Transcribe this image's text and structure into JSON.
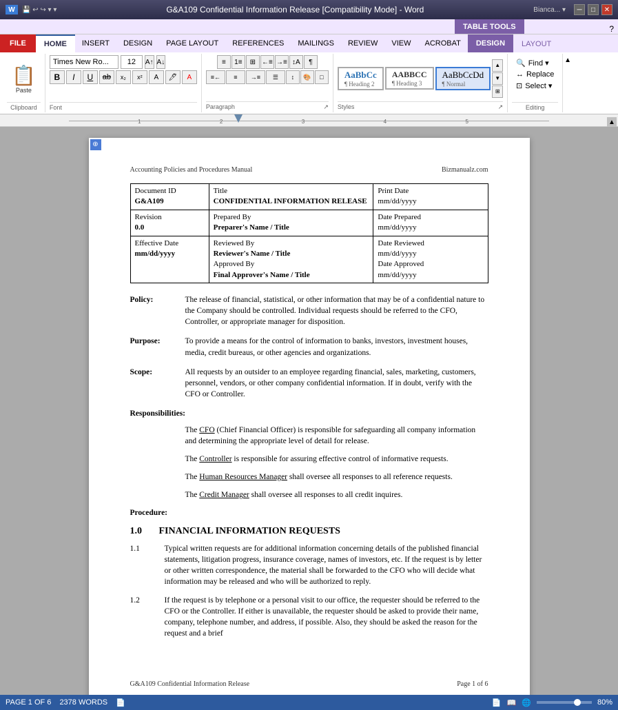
{
  "titlebar": {
    "title": "G&A109 Confidential Information Release [Compatibility Mode] - Word",
    "table_tools": "TABLE TOOLS",
    "icon": "W"
  },
  "tabs": {
    "main": [
      "FILE",
      "HOME",
      "INSERT",
      "DESIGN",
      "PAGE LAYOUT",
      "REFERENCES",
      "MAILINGS",
      "REVIEW",
      "VIEW",
      "ACROBAT"
    ],
    "table_tools": [
      "DESIGN",
      "LAYOUT"
    ],
    "active": "HOME",
    "active_table": "DESIGN"
  },
  "ribbon": {
    "font_name": "Times New Ro...",
    "font_size": "12",
    "paste_label": "Paste",
    "clipboard_label": "Clipboard",
    "font_label": "Font",
    "paragraph_label": "Paragraph",
    "styles_label": "Styles",
    "editing_label": "Editing"
  },
  "styles": {
    "items": [
      {
        "label": "AaBbCc",
        "sublabel": "¶ Heading 2",
        "type": "h2"
      },
      {
        "label": "AABBCC",
        "sublabel": "¶ Heading 3",
        "type": "h3"
      },
      {
        "label": "AaBbCcDd",
        "sublabel": "¶ Normal",
        "type": "normal",
        "selected": true
      }
    ]
  },
  "editing": {
    "find": "Find ▾",
    "replace": "Replace",
    "select": "Select ▾"
  },
  "document": {
    "header_left": "Accounting Policies and Procedures Manual",
    "header_right": "Bizmanualz.com",
    "table": {
      "rows": [
        [
          {
            "label": "Document ID",
            "value": "G&A109"
          },
          {
            "label": "Title",
            "value": "CONFIDENTIAL INFORMATION RELEASE"
          },
          {
            "label": "Print Date",
            "value": "mm/dd/yyyy"
          }
        ],
        [
          {
            "label": "Revision",
            "value": "0.0"
          },
          {
            "label": "Prepared By",
            "value": "Preparer's Name / Title"
          },
          {
            "label": "Date Prepared",
            "value": "mm/dd/yyyy"
          }
        ],
        [
          {
            "label": "Effective Date",
            "value": "mm/dd/yyyy"
          },
          {
            "label": "Reviewed By",
            "value": "Reviewer's Name / Title",
            "extra": "Approved By",
            "extra_value": "Final Approver's Name / Title"
          },
          {
            "label": "Date Reviewed",
            "value": "mm/dd/yyyy",
            "extra_label": "Date Approved",
            "extra_value": "mm/dd/yyyy"
          }
        ]
      ]
    },
    "policy": {
      "label": "Policy:",
      "text": "The release of financial, statistical, or other information that may be of a confidential nature to the Company should be controlled.  Individual requests should be referred to the CFO, Controller, or appropriate manager for disposition."
    },
    "purpose": {
      "label": "Purpose:",
      "text": "To provide a means for the control of information to banks, investors, investment houses, media, credit bureaus, or other agencies and organizations."
    },
    "scope": {
      "label": "Scope:",
      "text": "All requests by an outsider to an employee regarding financial, sales, marketing, customers, personnel, vendors, or other company confidential information.  If in doubt, verify with the CFO or Controller."
    },
    "responsibilities": {
      "title": "Responsibilities:",
      "items": [
        {
          "text": "The ",
          "underlined": "CFO",
          "after": " (Chief Financial Officer) is responsible for safeguarding all company information and determining the appropriate level of detail for release."
        },
        {
          "text": "The ",
          "underlined": "Controller",
          "after": " is responsible for assuring effective control of informative requests."
        },
        {
          "text": "The ",
          "underlined": "Human Resources Manager",
          "after": " shall oversee all responses to all reference requests."
        },
        {
          "text": "The ",
          "underlined": "Credit Manager",
          "after": " shall oversee all responses to all credit inquires."
        }
      ]
    },
    "procedure": {
      "title": "Procedure:",
      "sections": [
        {
          "num": "1.0",
          "title": "FINANCIAL INFORMATION REQUESTS",
          "subsections": [
            {
              "num": "1.1",
              "text": "Typical written requests are for additional information concerning details of the published financial statements, litigation progress, insurance coverage, names of investors, etc.  If the request is by letter or other written correspondence, the material shall be forwarded to the CFO who will decide what information may be released and who will be authorized to reply."
            },
            {
              "num": "1.2",
              "text": "If the request is by telephone or a personal visit to our office, the requester should be referred to the CFO or the Controller.  If either is unavailable, the requester should be asked to provide their name, company, telephone number, and address, if possible.  Also, they should be asked the reason for the request and a brief"
            }
          ]
        }
      ]
    },
    "footer_left": "G&A109 Confidential Information Release",
    "footer_right": "Page 1 of 6"
  },
  "statusbar": {
    "page_info": "PAGE 1 OF 6",
    "word_count": "2378 WORDS",
    "zoom": "80%"
  }
}
